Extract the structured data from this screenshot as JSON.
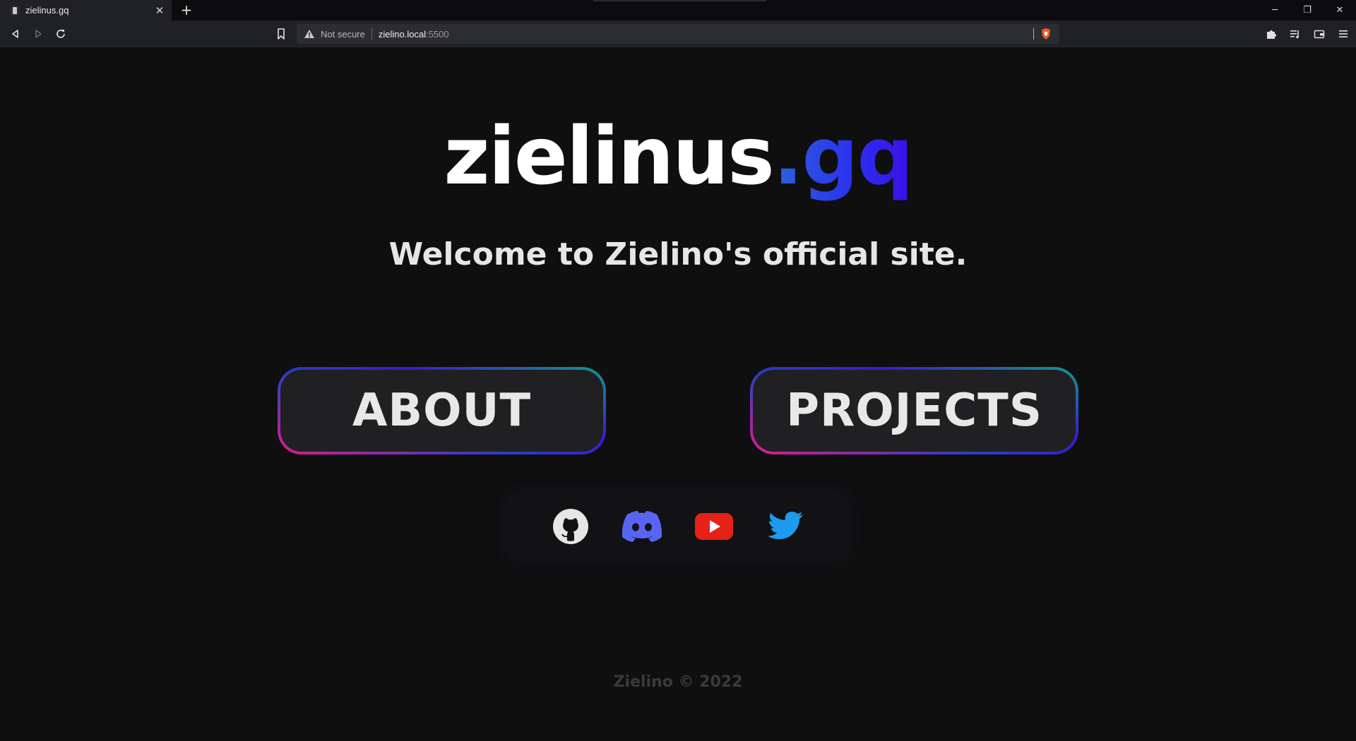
{
  "browser": {
    "tab_title": "zielinus.gq",
    "new_tab_icon": "plus-icon",
    "security_label": "Not secure",
    "url_host": "zielino.local",
    "url_port": ":5500"
  },
  "page": {
    "logo_main": "zielinus",
    "logo_tld": ".gq",
    "welcome": "Welcome to Zielino's official site.",
    "about_label": "ABOUT",
    "projects_label": "PROJECTS",
    "socials": [
      "github-icon",
      "discord-icon",
      "youtube-icon",
      "twitter-icon"
    ],
    "footer": "Zielino © 2022"
  },
  "colors": {
    "background": "#0f0f10",
    "tld_gradient_start": "#2d63d8",
    "tld_gradient_end": "#3a0fe6",
    "discord": "#5865f2",
    "youtube": "#e62117",
    "twitter": "#1d9bf0"
  }
}
